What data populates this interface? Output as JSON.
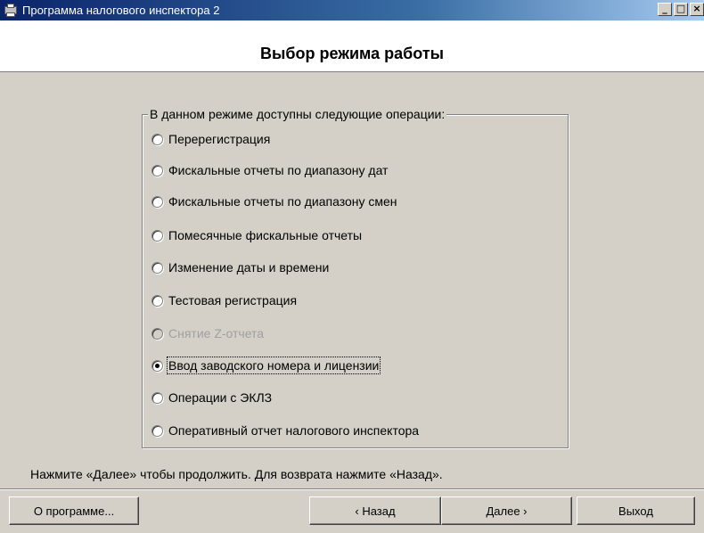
{
  "window": {
    "title": "Программа налогового инспектора 2",
    "controls": {
      "minimize": "_",
      "maximize": "□",
      "close": "×"
    }
  },
  "header": {
    "title": "Выбор режима работы"
  },
  "group": {
    "legend": "В данном режиме доступны следующие операции:",
    "options": [
      {
        "label": "Перерегистрация",
        "selected": false,
        "enabled": true
      },
      {
        "label": "Фискальные отчеты по диапазону дат",
        "selected": false,
        "enabled": true
      },
      {
        "label": "Фискальные отчеты по диапазону смен",
        "selected": false,
        "enabled": true
      },
      {
        "label": "Помесячные фискальные отчеты",
        "selected": false,
        "enabled": true
      },
      {
        "label": "Изменение даты и времени",
        "selected": false,
        "enabled": true
      },
      {
        "label": "Тестовая регистрация",
        "selected": false,
        "enabled": true
      },
      {
        "label": "Снятие Z-отчета",
        "selected": false,
        "enabled": false
      },
      {
        "label": "Ввод заводского номера и лицензии",
        "selected": true,
        "enabled": true
      },
      {
        "label": "Операции с ЭКЛЗ",
        "selected": false,
        "enabled": true
      },
      {
        "label": "Оперативный отчет налогового инспектора",
        "selected": false,
        "enabled": true
      }
    ]
  },
  "hint": "Нажмите «Далее» чтобы продолжить. Для возврата нажмите «Назад».",
  "buttons": {
    "about": "О программе...",
    "back": "‹ Назад",
    "next": "Далее ›",
    "exit": "Выход"
  }
}
